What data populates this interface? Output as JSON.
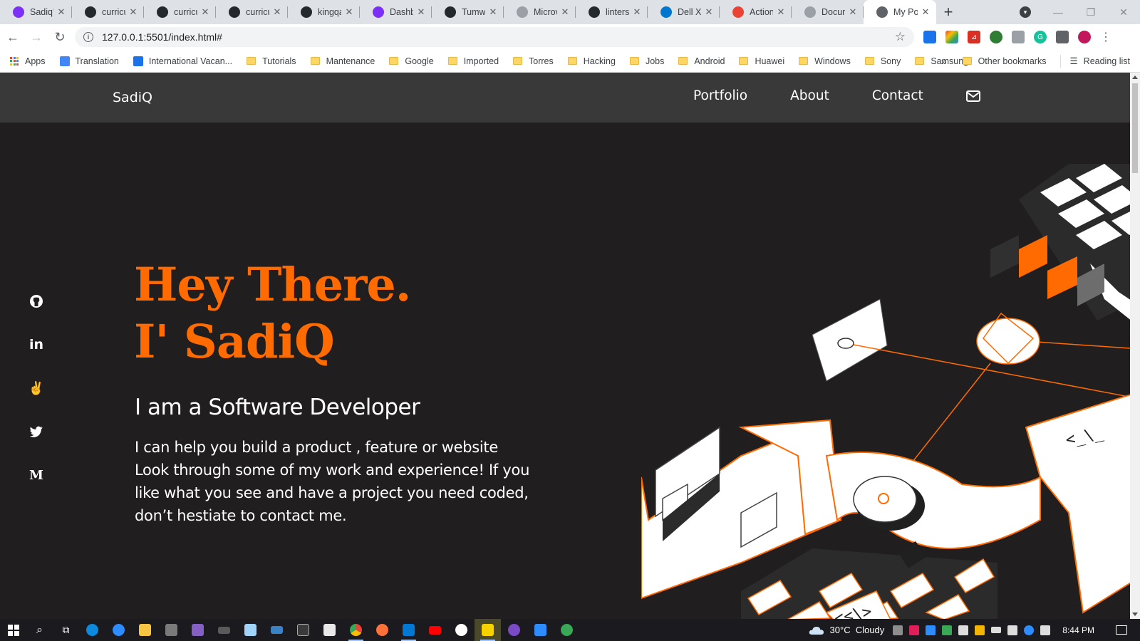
{
  "browser": {
    "tabs": [
      {
        "label": "Sadiq's",
        "icon": "netlify-icon",
        "color": "#7b2ff7"
      },
      {
        "label": "curricul",
        "icon": "github-icon",
        "color": "#24292e"
      },
      {
        "label": "curricul",
        "icon": "github-icon",
        "color": "#24292e"
      },
      {
        "label": "curricul",
        "icon": "github-icon",
        "color": "#24292e"
      },
      {
        "label": "kingqal",
        "icon": "github-icon",
        "color": "#24292e"
      },
      {
        "label": "Dashbo",
        "icon": "netlify-icon",
        "color": "#7b2ff7"
      },
      {
        "label": "Tumwo",
        "icon": "github-icon",
        "color": "#24292e"
      },
      {
        "label": "Microv",
        "icon": "globe-icon",
        "color": "#9aa0a6"
      },
      {
        "label": "linters-",
        "icon": "github-icon",
        "color": "#24292e"
      },
      {
        "label": "Dell XP",
        "icon": "dell-icon",
        "color": "#0076ce"
      },
      {
        "label": "Action",
        "icon": "gmail-icon",
        "color": "#ea4335"
      },
      {
        "label": "Docum",
        "icon": "globe-icon",
        "color": "#9aa0a6"
      },
      {
        "label": "My Por",
        "icon": "globe-icon",
        "color": "#5f6368",
        "active": true
      }
    ],
    "new_tab": "+",
    "url": "127.0.0.1:5501/index.html#",
    "bookmarks": [
      {
        "label": "Apps",
        "type": "apps"
      },
      {
        "label": "Translation",
        "type": "site"
      },
      {
        "label": "International Vacan...",
        "type": "site"
      },
      {
        "label": "Tutorials",
        "type": "folder"
      },
      {
        "label": "Mantenance",
        "type": "folder"
      },
      {
        "label": "Google",
        "type": "folder"
      },
      {
        "label": "Imported",
        "type": "folder"
      },
      {
        "label": "Torres",
        "type": "folder"
      },
      {
        "label": "Hacking",
        "type": "folder"
      },
      {
        "label": "Jobs",
        "type": "folder"
      },
      {
        "label": "Android",
        "type": "folder"
      },
      {
        "label": "Huawei",
        "type": "folder"
      },
      {
        "label": "Windows",
        "type": "folder"
      },
      {
        "label": "Sony",
        "type": "folder"
      },
      {
        "label": "Samsung",
        "type": "folder"
      }
    ],
    "more_bookmarks": "»",
    "other_bookmarks": "Other bookmarks",
    "reading_list": "Reading list"
  },
  "site": {
    "brand": "SadiQ",
    "nav": [
      "Portfolio",
      "About",
      "Contact"
    ],
    "socials": [
      "github-icon",
      "linkedin-icon",
      "angellist-icon",
      "twitter-icon",
      "medium-icon"
    ],
    "medium_letter": "M",
    "hero": {
      "line1": "Hey There.",
      "line2": "I' SadiQ",
      "subtitle": "I am a Software Developer",
      "text": "I can help you build a product , feature or website Look through some of my work and experience! If you like what you see and have a project you need coded, don’t hestiate to contact me."
    },
    "illustration_labels": [
      "<_\\_",
      "<<\\>"
    ],
    "colors": {
      "accent": "#ff6b00",
      "background": "#201e1f",
      "nav": "#393939"
    }
  },
  "taskbar": {
    "weather": "30°C  Cloudy",
    "time": "8:44 PM"
  }
}
